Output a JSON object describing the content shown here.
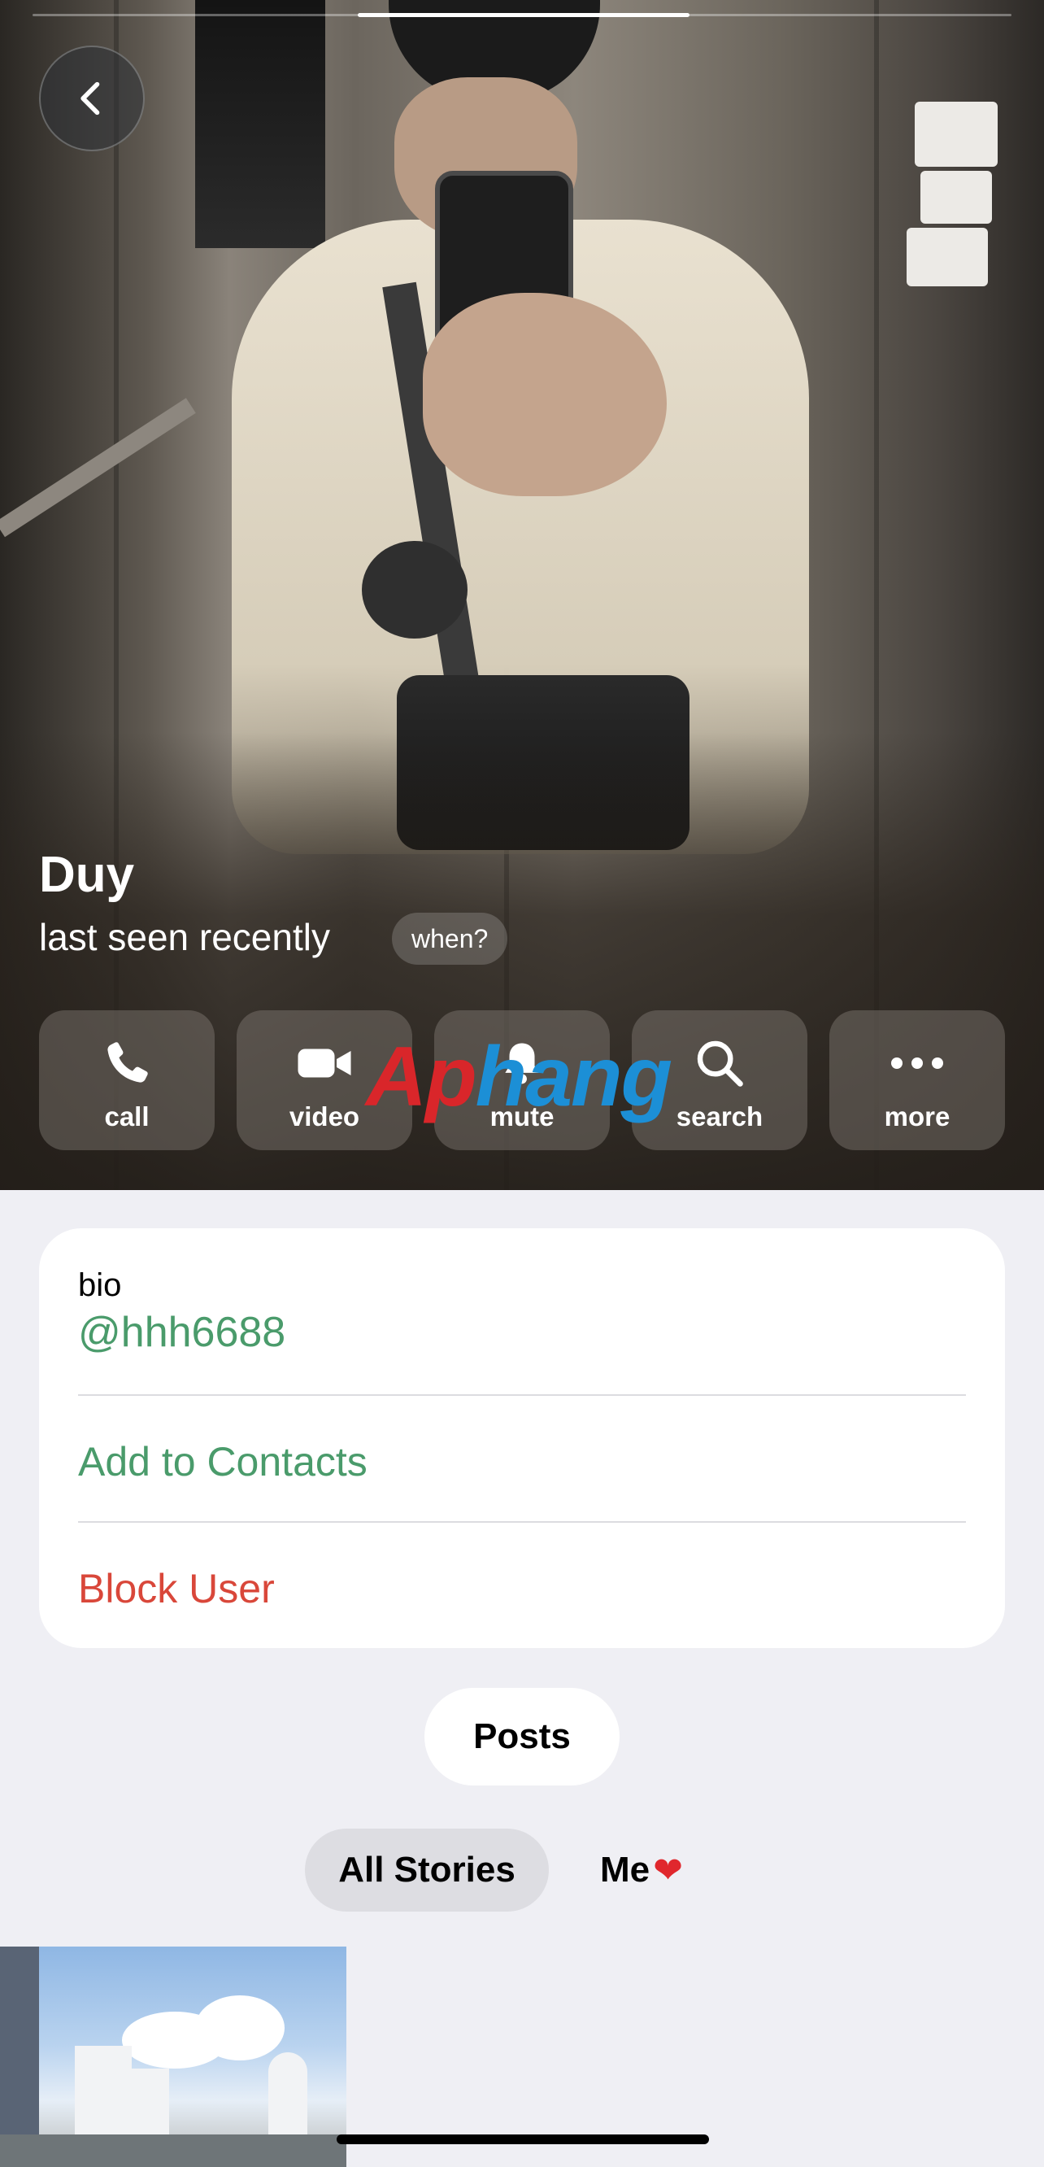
{
  "header": {
    "back_icon": "chevron-left-icon"
  },
  "profile": {
    "name": "Duy",
    "status": "last seen recently",
    "when_chip": "when?"
  },
  "actions": [
    {
      "label": "call",
      "icon": "phone-icon"
    },
    {
      "label": "video",
      "icon": "video-camera-icon"
    },
    {
      "label": "mute",
      "icon": "bell-icon"
    },
    {
      "label": "search",
      "icon": "search-icon"
    },
    {
      "label": "more",
      "icon": "more-dots-icon"
    }
  ],
  "watermark": {
    "part1": "Ap",
    "part2": "hang"
  },
  "info": {
    "bio_label": "bio",
    "bio_value": "@hhh6688",
    "add_contacts": "Add to Contacts",
    "block_user": "Block User"
  },
  "posts_button": "Posts",
  "story_tabs": {
    "all": "All Stories",
    "me": "Me",
    "me_emoji": "❤"
  },
  "colors": {
    "accent_green": "#4a9b6b",
    "destructive_red": "#d9473a",
    "background": "#efeff4"
  }
}
